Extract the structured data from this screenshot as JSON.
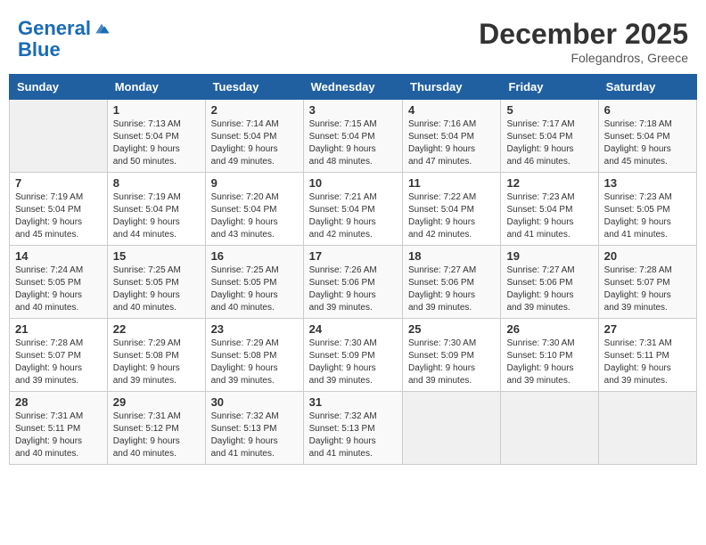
{
  "header": {
    "logo_line1": "General",
    "logo_line2": "Blue",
    "month": "December 2025",
    "location": "Folegandros, Greece"
  },
  "weekdays": [
    "Sunday",
    "Monday",
    "Tuesday",
    "Wednesday",
    "Thursday",
    "Friday",
    "Saturday"
  ],
  "weeks": [
    [
      {
        "day": "",
        "info": ""
      },
      {
        "day": "1",
        "info": "Sunrise: 7:13 AM\nSunset: 5:04 PM\nDaylight: 9 hours\nand 50 minutes."
      },
      {
        "day": "2",
        "info": "Sunrise: 7:14 AM\nSunset: 5:04 PM\nDaylight: 9 hours\nand 49 minutes."
      },
      {
        "day": "3",
        "info": "Sunrise: 7:15 AM\nSunset: 5:04 PM\nDaylight: 9 hours\nand 48 minutes."
      },
      {
        "day": "4",
        "info": "Sunrise: 7:16 AM\nSunset: 5:04 PM\nDaylight: 9 hours\nand 47 minutes."
      },
      {
        "day": "5",
        "info": "Sunrise: 7:17 AM\nSunset: 5:04 PM\nDaylight: 9 hours\nand 46 minutes."
      },
      {
        "day": "6",
        "info": "Sunrise: 7:18 AM\nSunset: 5:04 PM\nDaylight: 9 hours\nand 45 minutes."
      }
    ],
    [
      {
        "day": "7",
        "info": "Sunrise: 7:19 AM\nSunset: 5:04 PM\nDaylight: 9 hours\nand 45 minutes."
      },
      {
        "day": "8",
        "info": "Sunrise: 7:19 AM\nSunset: 5:04 PM\nDaylight: 9 hours\nand 44 minutes."
      },
      {
        "day": "9",
        "info": "Sunrise: 7:20 AM\nSunset: 5:04 PM\nDaylight: 9 hours\nand 43 minutes."
      },
      {
        "day": "10",
        "info": "Sunrise: 7:21 AM\nSunset: 5:04 PM\nDaylight: 9 hours\nand 42 minutes."
      },
      {
        "day": "11",
        "info": "Sunrise: 7:22 AM\nSunset: 5:04 PM\nDaylight: 9 hours\nand 42 minutes."
      },
      {
        "day": "12",
        "info": "Sunrise: 7:23 AM\nSunset: 5:04 PM\nDaylight: 9 hours\nand 41 minutes."
      },
      {
        "day": "13",
        "info": "Sunrise: 7:23 AM\nSunset: 5:05 PM\nDaylight: 9 hours\nand 41 minutes."
      }
    ],
    [
      {
        "day": "14",
        "info": "Sunrise: 7:24 AM\nSunset: 5:05 PM\nDaylight: 9 hours\nand 40 minutes."
      },
      {
        "day": "15",
        "info": "Sunrise: 7:25 AM\nSunset: 5:05 PM\nDaylight: 9 hours\nand 40 minutes."
      },
      {
        "day": "16",
        "info": "Sunrise: 7:25 AM\nSunset: 5:05 PM\nDaylight: 9 hours\nand 40 minutes."
      },
      {
        "day": "17",
        "info": "Sunrise: 7:26 AM\nSunset: 5:06 PM\nDaylight: 9 hours\nand 39 minutes."
      },
      {
        "day": "18",
        "info": "Sunrise: 7:27 AM\nSunset: 5:06 PM\nDaylight: 9 hours\nand 39 minutes."
      },
      {
        "day": "19",
        "info": "Sunrise: 7:27 AM\nSunset: 5:06 PM\nDaylight: 9 hours\nand 39 minutes."
      },
      {
        "day": "20",
        "info": "Sunrise: 7:28 AM\nSunset: 5:07 PM\nDaylight: 9 hours\nand 39 minutes."
      }
    ],
    [
      {
        "day": "21",
        "info": "Sunrise: 7:28 AM\nSunset: 5:07 PM\nDaylight: 9 hours\nand 39 minutes."
      },
      {
        "day": "22",
        "info": "Sunrise: 7:29 AM\nSunset: 5:08 PM\nDaylight: 9 hours\nand 39 minutes."
      },
      {
        "day": "23",
        "info": "Sunrise: 7:29 AM\nSunset: 5:08 PM\nDaylight: 9 hours\nand 39 minutes."
      },
      {
        "day": "24",
        "info": "Sunrise: 7:30 AM\nSunset: 5:09 PM\nDaylight: 9 hours\nand 39 minutes."
      },
      {
        "day": "25",
        "info": "Sunrise: 7:30 AM\nSunset: 5:09 PM\nDaylight: 9 hours\nand 39 minutes."
      },
      {
        "day": "26",
        "info": "Sunrise: 7:30 AM\nSunset: 5:10 PM\nDaylight: 9 hours\nand 39 minutes."
      },
      {
        "day": "27",
        "info": "Sunrise: 7:31 AM\nSunset: 5:11 PM\nDaylight: 9 hours\nand 39 minutes."
      }
    ],
    [
      {
        "day": "28",
        "info": "Sunrise: 7:31 AM\nSunset: 5:11 PM\nDaylight: 9 hours\nand 40 minutes."
      },
      {
        "day": "29",
        "info": "Sunrise: 7:31 AM\nSunset: 5:12 PM\nDaylight: 9 hours\nand 40 minutes."
      },
      {
        "day": "30",
        "info": "Sunrise: 7:32 AM\nSunset: 5:13 PM\nDaylight: 9 hours\nand 41 minutes."
      },
      {
        "day": "31",
        "info": "Sunrise: 7:32 AM\nSunset: 5:13 PM\nDaylight: 9 hours\nand 41 minutes."
      },
      {
        "day": "",
        "info": ""
      },
      {
        "day": "",
        "info": ""
      },
      {
        "day": "",
        "info": ""
      }
    ]
  ]
}
